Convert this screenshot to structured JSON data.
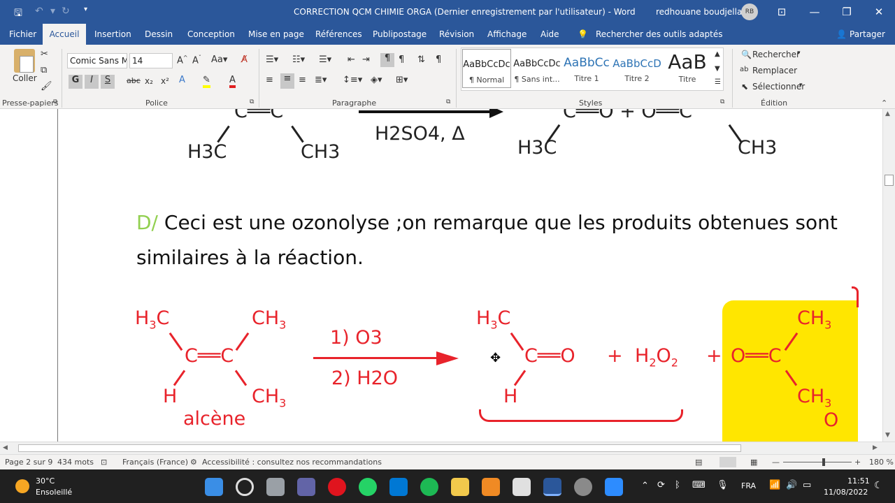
{
  "window": {
    "title": "CORRECTION QCM CHIMIE ORGA (Dernier enregistrement par l'utilisateur)  -  Word",
    "user": "redhouane boudjellal",
    "initials": "RB"
  },
  "menu": {
    "items": [
      "Fichier",
      "Accueil",
      "Insertion",
      "Dessin",
      "Conception",
      "Mise en page",
      "Références",
      "Publipostage",
      "Révision",
      "Affichage",
      "Aide"
    ],
    "search": "Rechercher des outils adaptés",
    "share": "Partager"
  },
  "ribbon": {
    "paste_label": "Coller",
    "font_name": "Comic Sans M",
    "font_size": "14",
    "groups": {
      "clipboard": "Presse-papiers",
      "font": "Police",
      "paragraph": "Paragraphe",
      "styles": "Styles",
      "editing": "Édition"
    },
    "styles": [
      {
        "preview": "AaBbCcDc",
        "name": "¶ Normal"
      },
      {
        "preview": "AaBbCcDc",
        "name": "¶ Sans int..."
      },
      {
        "preview": "AaBbCc",
        "name": "Titre 1"
      },
      {
        "preview": "AaBbCcD",
        "name": "Titre 2"
      },
      {
        "preview": "AaB",
        "name": "Titre"
      }
    ],
    "editing": {
      "find": "Rechercher",
      "replace": "Remplacer",
      "select": "Sélectionner"
    }
  },
  "document": {
    "top_reaction": {
      "left_top": "C══C",
      "left_h3c": "H3C",
      "left_ch3": "CH3",
      "arrow_cond": "H2SO4, Δ",
      "right_top": "C══O   +   O══C",
      "right_h3c": "H3C",
      "right_ch3": "CH3"
    },
    "para_prefix": "D/",
    "para_text": " Ceci est une ozonolyse ;on remarque que les produits obtenues sont similaires à la réaction.",
    "ozonolysis": {
      "step1": "1) O3",
      "step2": "2) H2O",
      "alkene_name": "alcène",
      "plus1": "+",
      "h2o2": "H2O2",
      "plus2": "+"
    }
  },
  "status": {
    "page": "Page 2 sur 9",
    "words": "434 mots",
    "language": "Français (France)",
    "accessibility": "Accessibilité : consultez nos recommandations",
    "zoom": "180 %"
  },
  "taskbar": {
    "temp": "30°C",
    "weather": "Ensoleillé",
    "lang": "FRA",
    "time": "11:51",
    "date": "11/08/2022"
  }
}
